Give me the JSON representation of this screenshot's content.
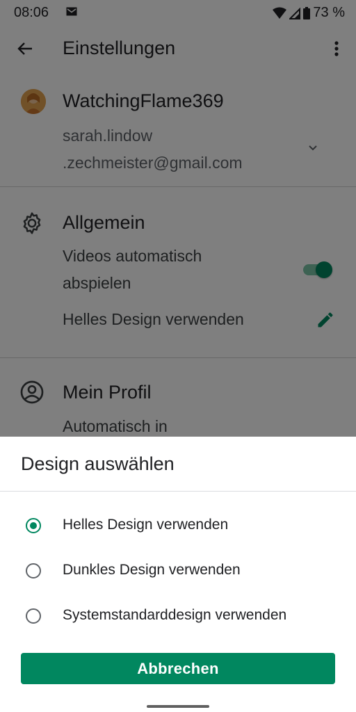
{
  "status_bar": {
    "time": "08:06",
    "battery": "73 %"
  },
  "header": {
    "title": "Einstellungen"
  },
  "account": {
    "name": "WatchingFlame369",
    "email_line1": "sarah.lindow",
    "email_line2": ".zechmeister@gmail.com"
  },
  "general": {
    "title": "Allgemein",
    "autoplay_line1": "Videos automatisch",
    "autoplay_line2": "abspielen",
    "autoplay_on": true,
    "theme_label": "Helles Design verwenden"
  },
  "profile": {
    "title": "Mein Profil",
    "partial_text": "Automatisch in"
  },
  "dialog": {
    "title": "Design auswählen",
    "options": [
      {
        "label": "Helles Design verwenden",
        "selected": true
      },
      {
        "label": "Dunkles Design verwenden",
        "selected": false
      },
      {
        "label": "Systemstandarddesign verwenden",
        "selected": false
      }
    ],
    "cancel_label": "Abbrechen"
  },
  "colors": {
    "accent": "#01875f",
    "scrim": "rgba(0,0,0,0.5)"
  },
  "icons": [
    "mail-icon",
    "wifi-icon",
    "signal-icon",
    "battery-icon",
    "back-arrow-icon",
    "more-vert-icon",
    "chevron-down-icon",
    "gear-icon",
    "edit-pencil-icon",
    "account-circle-icon"
  ]
}
